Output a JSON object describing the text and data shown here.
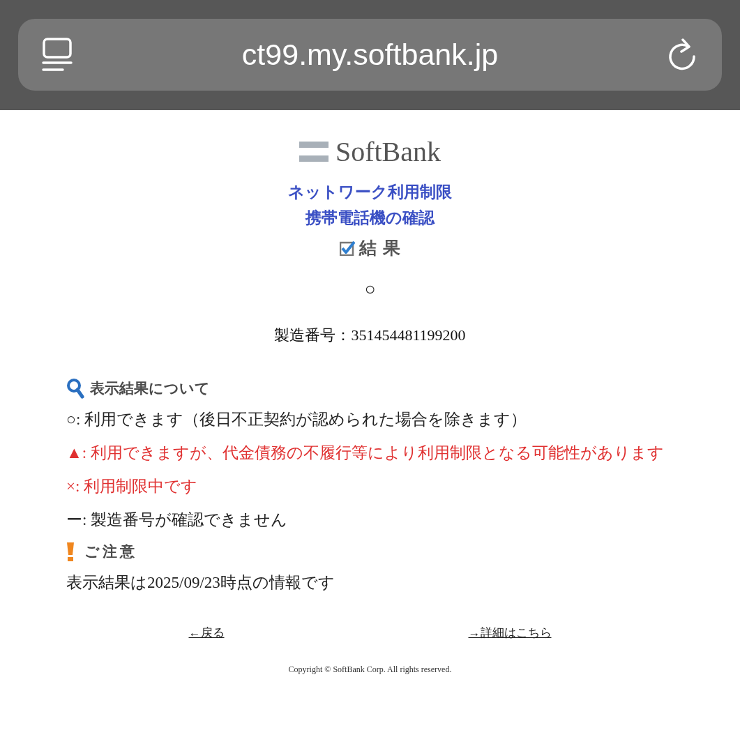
{
  "browser": {
    "url": "ct99.my.softbank.jp"
  },
  "logo": {
    "text": "SoftBank"
  },
  "title_lines": [
    "ネットワーク利用制限",
    "携帯電話機の確認"
  ],
  "result_heading": "結 果",
  "result_symbol": "○",
  "serial": "製造番号：351454481199200",
  "legend_heading": "表示結果について",
  "legend": [
    {
      "text": "○: 利用できます（後日不正契約が認められた場合を除きます）",
      "color": "#222222"
    },
    {
      "text": "▲: 利用できますが、代金債務の不履行等により利用制限となる可能性があります",
      "color": "#e03030"
    },
    {
      "text": "×: 利用制限中です",
      "color": "#e03030"
    },
    {
      "text": "ー: 製造番号が確認できません",
      "color": "#222222"
    }
  ],
  "notice_heading": "ご注意",
  "notice": "表示結果は2025/09/23時点の情報です",
  "links": [
    "←戻る",
    "→詳細はこちら"
  ],
  "copyright": "Copyright © SoftBank Corp. All rights reserved."
}
